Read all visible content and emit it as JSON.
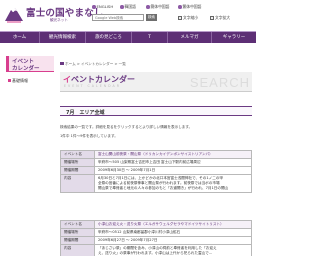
{
  "header": {
    "site_title": "富士の国やまなし",
    "site_subtitle": "観光ネット",
    "languages": [
      "ENGLISH",
      "韓国語",
      "簡体中国語",
      "繁体中国語"
    ],
    "search_placeholder": "Google Web検索",
    "search_button": "検索",
    "font_size_small": "文字縮小",
    "font_size_large": "文字拡大"
  },
  "nav": {
    "items": [
      "ホーム",
      "観光情報検索",
      "旅の見どころ",
      "T",
      "メルマガ",
      "ギャラリー"
    ]
  },
  "sidebar": {
    "title_line1": "イベント",
    "title_line2": "カレンダー",
    "link": "基礎情報"
  },
  "breadcrumb": {
    "items": [
      "ホーム",
      "イベントカレンダー",
      "一覧"
    ]
  },
  "banner": {
    "title_prefix": "イ",
    "title_rest": "ベントカレンダー",
    "subtitle": "EVENT CALENDAR",
    "bg_text": "SEARCH"
  },
  "month_bar": {
    "text": "7月　エリア全域"
  },
  "intro": {
    "line1": "検索結果の一覧です。詳細を見るをクリックするとより詳しい情報を表示します。",
    "line2": "1件中 1件〜9件を表示しています。"
  },
  "events": [
    {
      "name_label": "イベント名",
      "name": "富士山開山前夜祭・開山祭（ドリカンカイデンボンサイストリアンパ）",
      "venue_label": "開催場所",
      "venue": "甲府市〜505 山梨県富士吉田市上吉田 富士山下駅内前広場周辺",
      "period_label": "開催期間",
      "period": "2009年6月30日 〜 2009年7月1日",
      "summary_label": "内容",
      "summary_lines": [
        "6月30日と7月1日には、上かどかの北口本宮富士浅間神社で、その1ノ二の甲",
        "全祭の宮番による前夜祭神事と開山祭が行われます。前夜祭では当ボの市場",
        "開山祭で奉賛者と地元の人々の参加のもと「お道開き」が行われ、7月1日の開山"
      ]
    },
    {
      "name_label": "イベント名",
      "name": "小淳山お迎え火・送り火祭（エルガサウェルグセラやマドイツサイトリスト）",
      "venue_label": "開催場所",
      "venue": "甲府市〜0512 山梨県南都留郡小淳川村小淳山鉱石",
      "period_label": "開催期間",
      "period": "2009年6月27日 〜 2009年7月27日",
      "summary_label": "内容",
      "summary_lines": [
        "「あじさい祭」の期間を含み、小淳山の祠前と奉賛者を利用した「お迎え",
        "え、送り火」の祭事が行われます。小淳山は上代から祀られた霊山で..."
      ]
    }
  ]
}
